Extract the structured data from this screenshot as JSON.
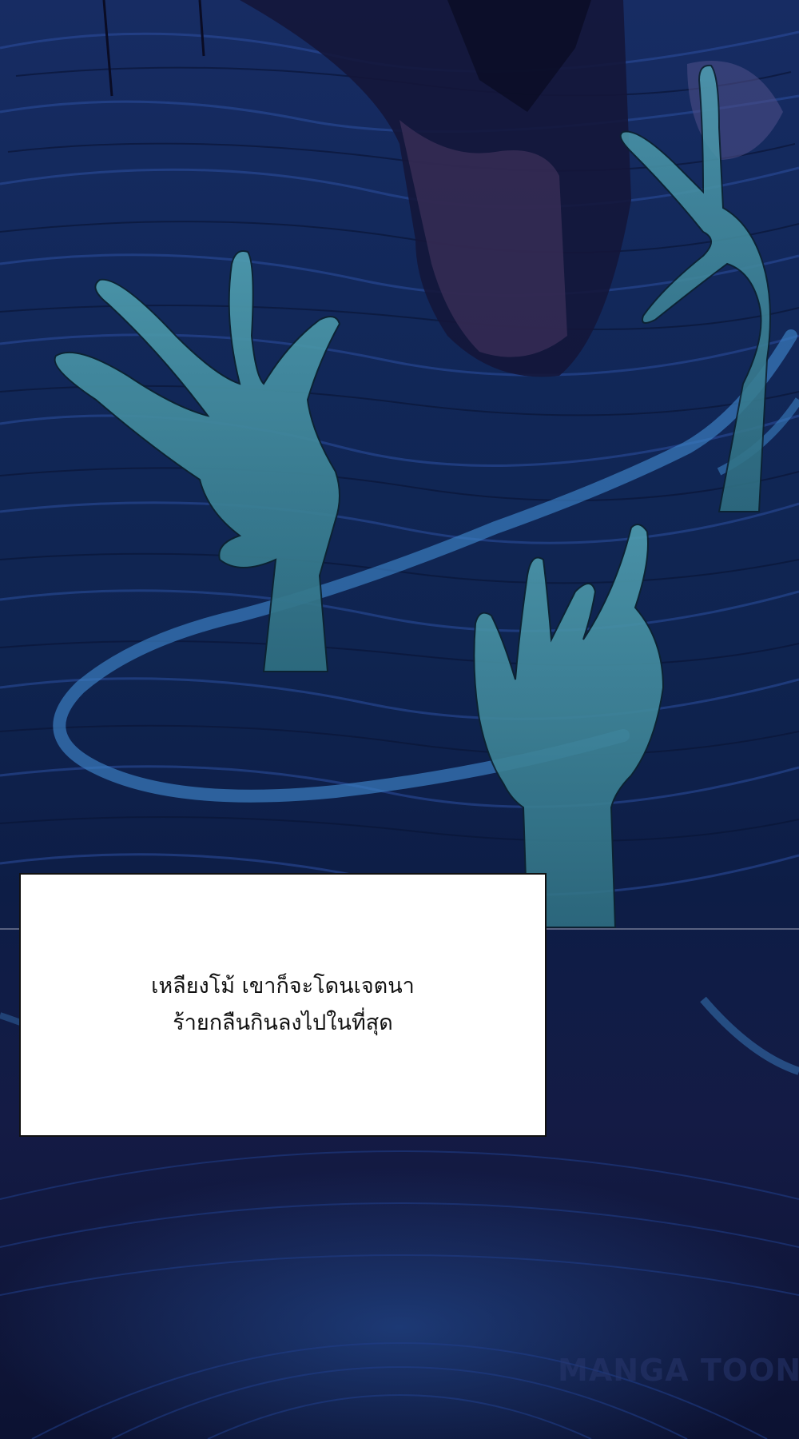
{
  "caption": {
    "lines": [
      "เหลียงโม้ เขาก็จะโดนเจตนา",
      "ร้ายกลืนกินลงไปในที่สุด"
    ]
  },
  "watermark": {
    "text": "MANGA TOON"
  },
  "colors": {
    "background_top": "#172c63",
    "background_bottom": "#0c1232",
    "hand_fill": "#3f8e9e",
    "wisp": "#3a7ec0",
    "caption_bg": "#ffffff",
    "caption_text": "#111111"
  }
}
